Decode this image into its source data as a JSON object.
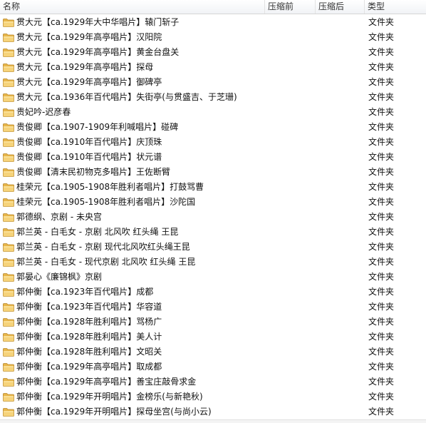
{
  "columns": {
    "name": "名称",
    "compressed": "压缩前",
    "uncompressed": "压缩后",
    "type": "类型"
  },
  "folder_icon": "folder-icon",
  "rows": [
    {
      "name": "贯大元【ca.1929年大中华唱片】辕门斩子",
      "type": "文件夹"
    },
    {
      "name": "贯大元【ca.1929年高亭唱片】汉阳院",
      "type": "文件夹"
    },
    {
      "name": "贯大元【ca.1929年高亭唱片】黄金台盘关",
      "type": "文件夹"
    },
    {
      "name": "贯大元【ca.1929年高亭唱片】探母",
      "type": "文件夹"
    },
    {
      "name": "贯大元【ca.1929年高亭唱片】御碑亭",
      "type": "文件夹"
    },
    {
      "name": "贯大元【ca.1936年百代唱片】失街亭(与贯盛吉、于芝珊)",
      "type": "文件夹"
    },
    {
      "name": "贵妃吟-迟彦春",
      "type": "文件夹"
    },
    {
      "name": "贵俊卿【ca.1907-1909年利喊唱片】碰碑",
      "type": "文件夹"
    },
    {
      "name": "贵俊卿【ca.1910年百代唱片】庆顶珠",
      "type": "文件夹"
    },
    {
      "name": "贵俊卿【ca.1910年百代唱片】状元谱",
      "type": "文件夹"
    },
    {
      "name": "贵俊卿【清末民初物克多唱片】王佐断臂",
      "type": "文件夹"
    },
    {
      "name": "桂荣元【ca.1905-1908年胜利者唱片】打鼓骂曹",
      "type": "文件夹"
    },
    {
      "name": "桂荣元【ca.1905-1908年胜利者唱片】沙陀国",
      "type": "文件夹"
    },
    {
      "name": "郭德纲、京剧 - 未央宫",
      "type": "文件夹"
    },
    {
      "name": "郭兰英 - 白毛女 - 京剧 北风吹 红头绳 王昆",
      "type": "文件夹"
    },
    {
      "name": "郭兰英 - 白毛女 - 京剧 现代北风吹红头绳王昆",
      "type": "文件夹"
    },
    {
      "name": "郭兰英 - 白毛女 - 现代京剧 北风吹 红头绳 王昆",
      "type": "文件夹"
    },
    {
      "name": "郭晏心《廉锦枫》京剧",
      "type": "文件夹"
    },
    {
      "name": "郭仲衡【ca.1923年百代唱片】成都",
      "type": "文件夹"
    },
    {
      "name": "郭仲衡【ca.1923年百代唱片】华容道",
      "type": "文件夹"
    },
    {
      "name": "郭仲衡【ca.1928年胜利唱片】骂杨广",
      "type": "文件夹"
    },
    {
      "name": "郭仲衡【ca.1928年胜利唱片】美人计",
      "type": "文件夹"
    },
    {
      "name": "郭仲衡【ca.1928年胜利唱片】文昭关",
      "type": "文件夹"
    },
    {
      "name": "郭仲衡【ca.1929年高亭唱片】取成都",
      "type": "文件夹"
    },
    {
      "name": "郭仲衡【ca.1929年高亭唱片】善宝庄敲骨求金",
      "type": "文件夹"
    },
    {
      "name": "郭仲衡【ca.1929年开明唱片】金榜乐(与新艳秋)",
      "type": "文件夹"
    },
    {
      "name": "郭仲衡【ca.1929年开明唱片】探母坐宫(与尚小云)",
      "type": "文件夹"
    }
  ]
}
